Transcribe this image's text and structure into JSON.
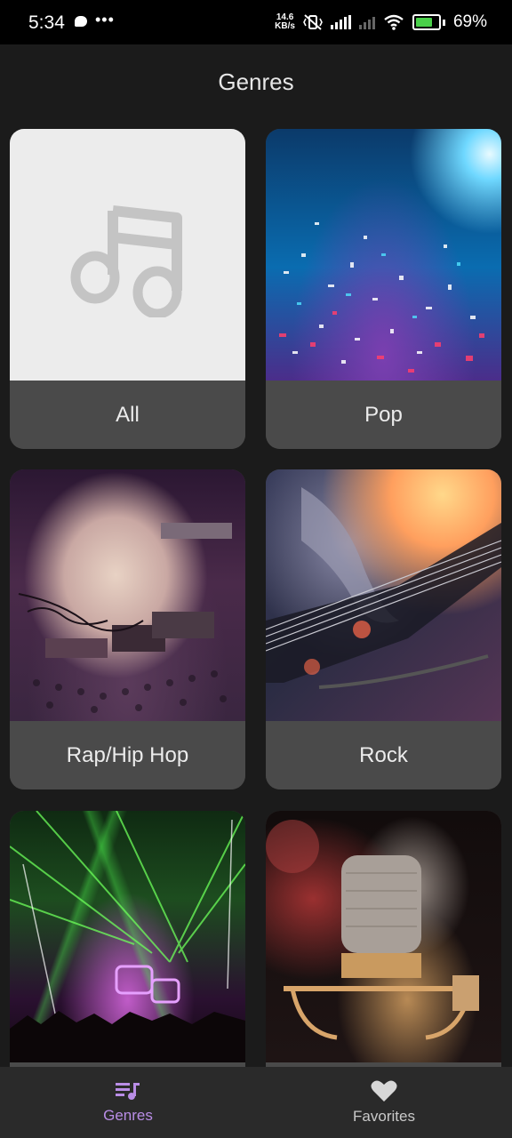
{
  "status_bar": {
    "time": "5:34",
    "net_speed_value": "14.6",
    "net_speed_unit": "KB/s",
    "battery_percent": "69%",
    "icons": [
      "message-icon",
      "more-dots-icon",
      "vibrate-off-icon",
      "signal-icon",
      "signal-icon-2",
      "wifi-icon",
      "battery-charging-icon"
    ]
  },
  "header": {
    "title": "Genres"
  },
  "genres": [
    {
      "label": "All",
      "image": "music-note-placeholder"
    },
    {
      "label": "Pop",
      "image": "confetti-concert-photo"
    },
    {
      "label": "Rap/Hip Hop",
      "image": "dj-equipment-photo"
    },
    {
      "label": "Rock",
      "image": "electric-guitar-photo"
    },
    {
      "label": "",
      "image": "laser-show-photo"
    },
    {
      "label": "",
      "image": "studio-microphone-photo"
    }
  ],
  "bottom_nav": {
    "items": [
      {
        "label": "Genres",
        "icon": "playlist-icon",
        "active": true
      },
      {
        "label": "Favorites",
        "icon": "heart-icon",
        "active": false
      }
    ],
    "active_color": "#b98de6"
  },
  "colors": {
    "background": "#1b1b1b",
    "card_label_bg": "#4a4a4a",
    "nav_bg": "#2a2a2a"
  }
}
